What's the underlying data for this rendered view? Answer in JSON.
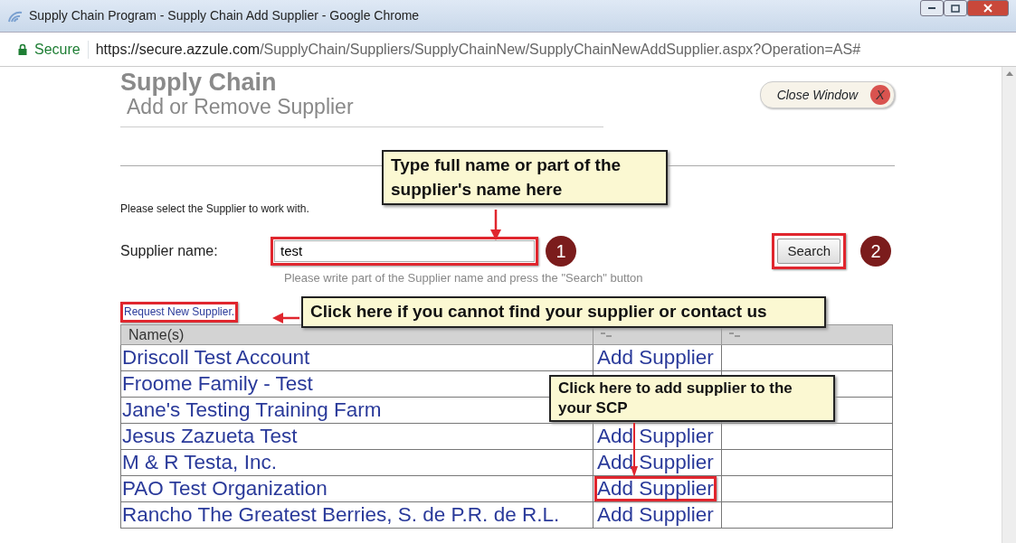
{
  "window": {
    "title": "Supply Chain Program - Supply Chain Add Supplier - Google Chrome"
  },
  "address_bar": {
    "secure_label": "Secure",
    "url_host": "https://secure.azzule.com",
    "url_path": "/SupplyChain/Suppliers/SupplyChainNew/SupplyChainNewAddSupplier.aspx?Operation=AS#"
  },
  "header": {
    "title": "Supply Chain",
    "subtitle": "Add or Remove Supplier",
    "close_button": "Close Window",
    "close_icon": "X"
  },
  "instruction": "Please select the Supplier to work with.",
  "search": {
    "label": "Supplier name:",
    "value": "test",
    "hint": "Please write part of the Supplier name and press the \"Search\" button",
    "button": "Search",
    "field_highlighted": true,
    "button_highlighted": true
  },
  "request_link": {
    "text": "Request New Supplier.",
    "highlighted": true
  },
  "table": {
    "columns": [
      "Name(s)"
    ],
    "rows": [
      {
        "name": "Driscoll Test Account",
        "action": "Add Supplier",
        "highlighted": false
      },
      {
        "name": "Froome Family - Test",
        "highlighted": false
      },
      {
        "name": "Jane's Testing Training Farm",
        "highlighted": false
      },
      {
        "name": "Jesus Zazueta Test",
        "action": "Add Supplier",
        "highlighted": false
      },
      {
        "name": "M & R Testa, Inc.",
        "action": "Add Supplier",
        "highlighted": false
      },
      {
        "name": "PAO Test Organization",
        "action": "Add Supplier",
        "highlighted": true
      },
      {
        "name": "Rancho The Greatest Berries, S. de P.R. de R.L.",
        "action": "Add Supplier",
        "highlighted": false
      }
    ]
  },
  "annotations": {
    "callouts": [
      "Type full name or part of the supplier's name here",
      "Click here if you cannot find your supplier or contact us",
      "Click here to add supplier to the your SCP"
    ],
    "step_markers": [
      "1",
      "2"
    ]
  }
}
